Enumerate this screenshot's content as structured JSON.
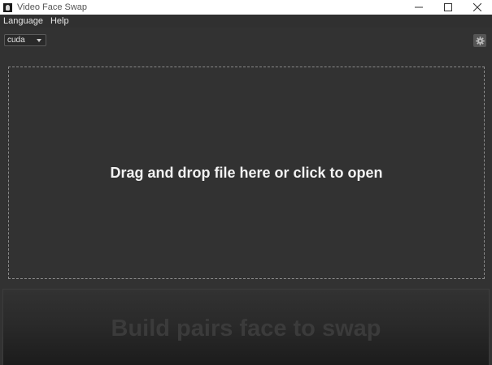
{
  "window": {
    "title": "Video Face Swap"
  },
  "menu": {
    "items": [
      "Language",
      "Help"
    ]
  },
  "toolbar": {
    "device_selected": "cuda",
    "settings_icon": "gear-icon"
  },
  "dropzone": {
    "text": "Drag and drop file here or click to open"
  },
  "pairs": {
    "text": "Build pairs face to swap"
  },
  "colors": {
    "background": "#323232",
    "titlebar": "#ffffff",
    "dropzone_border": "#8a8a8a",
    "text_primary": "#f2f2f2",
    "text_faded": "#3b3b3b"
  }
}
